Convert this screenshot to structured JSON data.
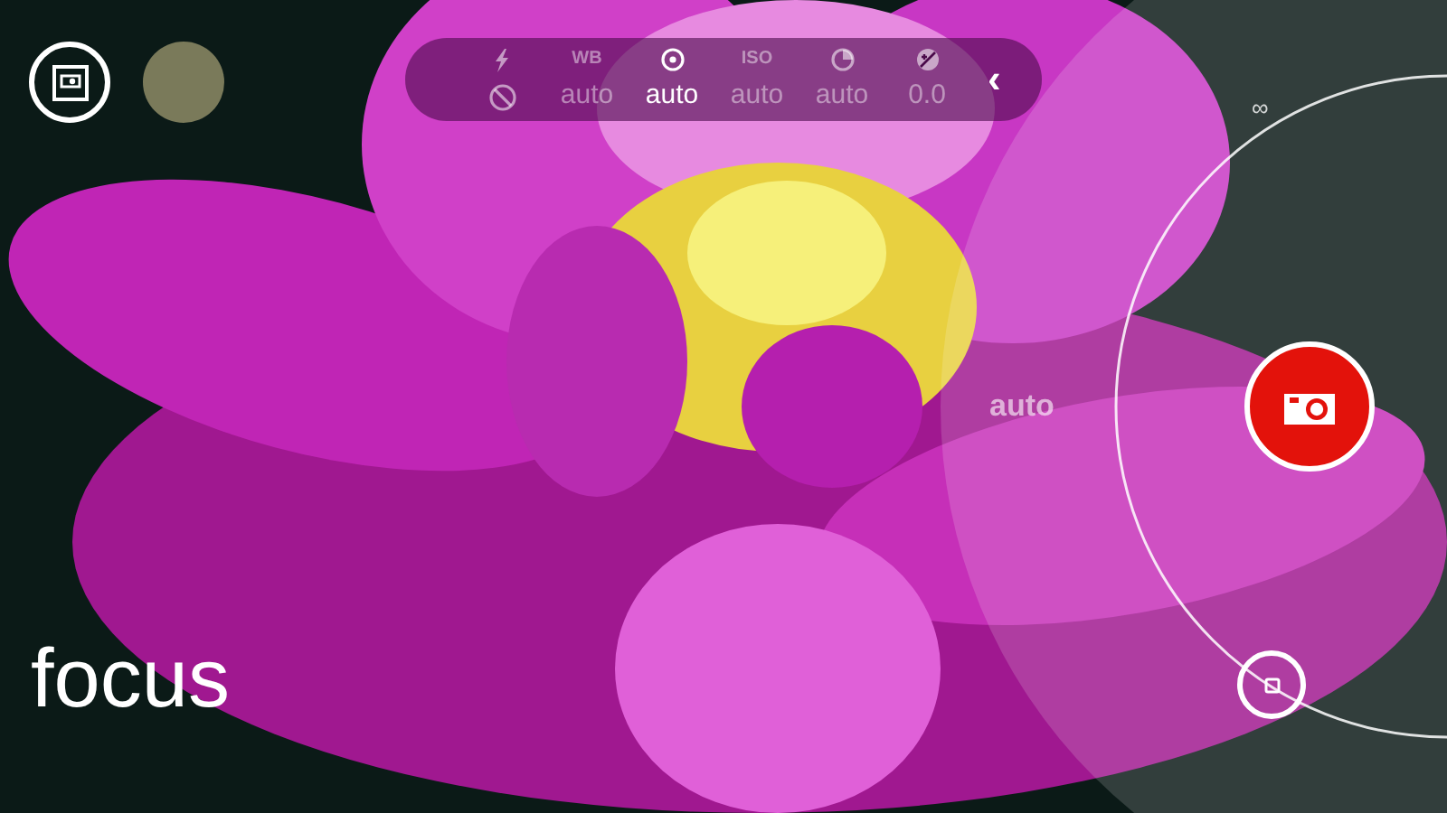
{
  "settings": [
    {
      "kind": "flash",
      "selected": false
    },
    {
      "kind": "text",
      "label": "WB",
      "value": "auto",
      "selected": false
    },
    {
      "kind": "focus",
      "value": "auto",
      "selected": true
    },
    {
      "kind": "text",
      "label": "ISO",
      "value": "auto",
      "selected": false
    },
    {
      "kind": "shutter",
      "value": "auto",
      "selected": false
    },
    {
      "kind": "exposure",
      "value": "0.0",
      "selected": false
    }
  ],
  "collapse_button": "‹",
  "dial": {
    "top_label": "∞",
    "value": "auto"
  },
  "mode_label": "focus"
}
